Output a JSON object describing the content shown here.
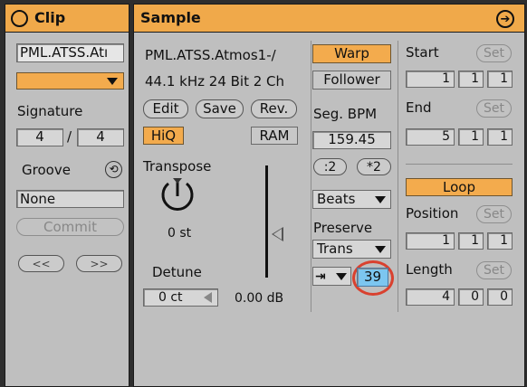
{
  "clip": {
    "title": "Clip",
    "name": "PML.ATSS.Atı",
    "signature_label": "Signature",
    "sig_num": "4",
    "sig_slash": "/",
    "sig_den": "4",
    "groove_label": "Groove",
    "groove_value": "None",
    "commit_label": "Commit",
    "nudge_back": "<<",
    "nudge_fwd": ">>"
  },
  "sample": {
    "title": "Sample",
    "name": "PML.ATSS.Atmos1-/",
    "info": "44.1 kHz 24 Bit 2 Ch",
    "edit_label": "Edit",
    "save_label": "Save",
    "rev_label": "Rev.",
    "hiq_label": "HiQ",
    "ram_label": "RAM",
    "transpose_label": "Transpose",
    "transpose_value": "0 st",
    "detune_label": "Detune",
    "detune_value": "0 ct",
    "gain_value": "0.00 dB",
    "warp_label": "Warp",
    "follower_label": "Follower",
    "segbpm_label": "Seg. BPM",
    "segbpm_value": "159.45",
    "half_label": ":2",
    "double_label": "*2",
    "mode_value": "Beats",
    "preserve_label": "Preserve",
    "preserve_value": "Trans",
    "envelope_value": "39",
    "start_label": "Start",
    "end_label": "End",
    "set_label": "Set",
    "start_bar": "1",
    "start_beat": "1",
    "start_six": "1",
    "end_bar": "5",
    "end_beat": "1",
    "end_six": "1",
    "loop_label": "Loop",
    "position_label": "Position",
    "pos_bar": "1",
    "pos_beat": "1",
    "pos_six": "1",
    "length_label": "Length",
    "len_bar": "4",
    "len_beat": "0",
    "len_six": "0"
  },
  "colors": {
    "accent": "#f0a94a",
    "panel": "#bfbfbf",
    "highlight_field": "#7cc6f0",
    "annotation_circle": "#d9412f"
  }
}
